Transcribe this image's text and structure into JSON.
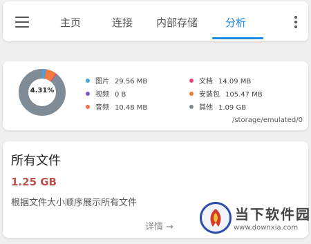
{
  "nav": {
    "tabs": [
      {
        "label": "主页",
        "active": false
      },
      {
        "label": "连接",
        "active": false
      },
      {
        "label": "内部存储",
        "active": false
      },
      {
        "label": "分析",
        "active": true
      }
    ],
    "menu_icon": "hamburger-menu-icon",
    "more_icon": "more-vertical-icon",
    "accent_color": "#1e88e5"
  },
  "storage": {
    "used_percent_label": "4.31%",
    "categories": [
      {
        "label": "图片",
        "size": "29.56 MB",
        "color": "#4aa3df"
      },
      {
        "label": "视频",
        "size": "0 B",
        "color": "#7e57c2"
      },
      {
        "label": "音频",
        "size": "10.48 MB",
        "color": "#ef6f4d"
      },
      {
        "label": "文档",
        "size": "14.09 MB",
        "color": "#e84a75"
      },
      {
        "label": "安装包",
        "size": "105.47 MB",
        "color": "#f07b3f"
      },
      {
        "label": "其他",
        "size": "1.09 GB",
        "color": "#7f8c97"
      }
    ],
    "path": "/storage/emulated/0"
  },
  "all_files": {
    "title": "所有文件",
    "size": "1.25 GB",
    "description": "根据文件大小顺序展示所有文件",
    "details_label": "详情 →"
  },
  "watermark": {
    "title": "当下软件园",
    "url": "www.downxia.com"
  }
}
